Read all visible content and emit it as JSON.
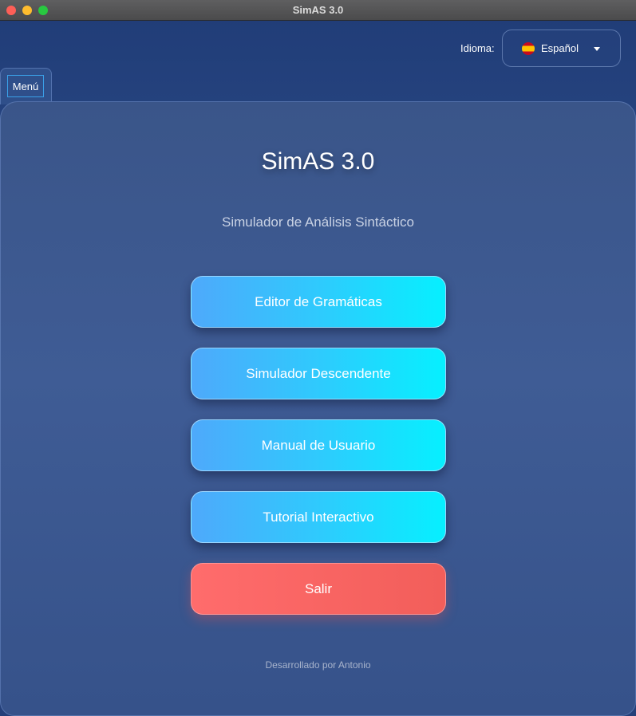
{
  "window": {
    "title": "SimAS 3.0"
  },
  "language": {
    "label": "Idioma:",
    "selected": "Español",
    "flag_icon": "spain-flag-icon"
  },
  "menu": {
    "label": "Menú"
  },
  "main": {
    "title": "SimAS 3.0",
    "subtitle": "Simulador de Análisis Sintáctico",
    "buttons": [
      {
        "label": "Editor de Gramáticas"
      },
      {
        "label": "Simulador Descendente"
      },
      {
        "label": "Manual de Usuario"
      },
      {
        "label": "Tutorial Interactivo"
      }
    ],
    "exit_label": "Salir",
    "footer": "Desarrollado por Antonio"
  },
  "colors": {
    "background": "#2c4c88",
    "primary_button_start": "#4ea9fb",
    "primary_button_end": "#06f0ff",
    "exit_button": "#f25e5a"
  }
}
